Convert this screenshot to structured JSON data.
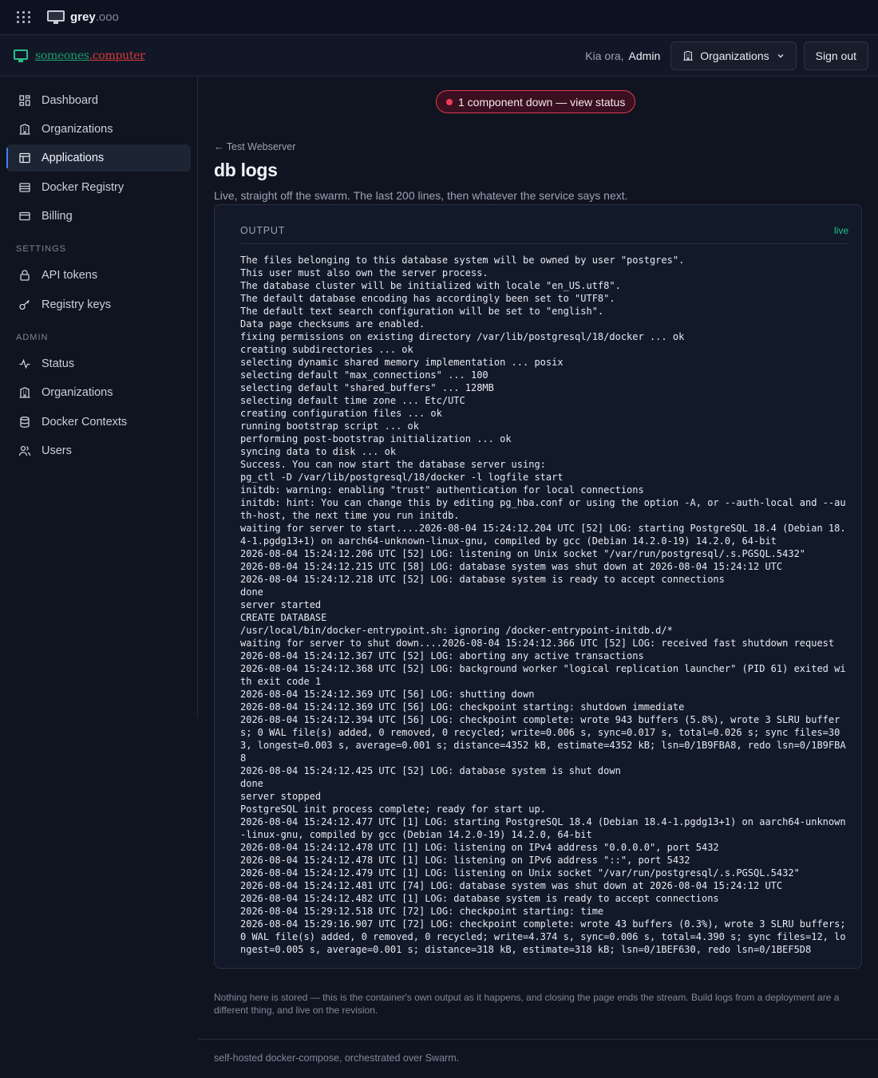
{
  "topbar": {
    "brand_name": "grey",
    "brand_suffix": ".ooo",
    "icons": [
      "grid-menu-icon",
      "monitor-icon"
    ]
  },
  "header": {
    "logo_part1": "someones",
    "logo_part2": ".computer",
    "greeting": "Kia ora,",
    "user_name": "Admin",
    "organizations_label": "Organizations",
    "signout_label": "Sign out"
  },
  "sidebar": {
    "items": [
      {
        "label": "Dashboard",
        "icon": "dashboard-icon"
      },
      {
        "label": "Organizations",
        "icon": "building-icon"
      },
      {
        "label": "Applications",
        "icon": "layout-icon",
        "active": true
      },
      {
        "label": "Docker Registry",
        "icon": "registry-icon"
      }
    ],
    "items2": [
      {
        "label": "Billing",
        "icon": "card-icon"
      }
    ],
    "settings_label": "SETTINGS",
    "settings_items": [
      {
        "label": "API tokens",
        "icon": "lock-icon"
      },
      {
        "label": "Registry keys",
        "icon": "key-icon"
      }
    ],
    "admin_label": "ADMIN",
    "admin_items": [
      {
        "label": "Status",
        "icon": "activity-icon"
      },
      {
        "label": "Organizations",
        "icon": "building-icon"
      },
      {
        "label": "Docker Contexts",
        "icon": "database-icon"
      },
      {
        "label": "Users",
        "icon": "users-icon"
      }
    ]
  },
  "main": {
    "status_banner": "1 component down — view status",
    "back_link": "Test Webserver",
    "title": "db logs",
    "subtitle": "Live, straight off the swarm. The last 200 lines, then whatever the service says next.",
    "output_label": "OUTPUT",
    "live_label": "live",
    "log_lines": [
      "The files belonging to this database system will be owned by user \"postgres\".",
      "This user must also own the server process.",
      "The database cluster will be initialized with locale \"en_US.utf8\".",
      "The default database encoding has accordingly been set to \"UTF8\".",
      "The default text search configuration will be set to \"english\".",
      "Data page checksums are enabled.",
      "fixing permissions on existing directory /var/lib/postgresql/18/docker ... ok",
      "creating subdirectories ... ok",
      "selecting dynamic shared memory implementation ... posix",
      "selecting default \"max_connections\" ... 100",
      "selecting default \"shared_buffers\" ... 128MB",
      "selecting default time zone ... Etc/UTC",
      "creating configuration files ... ok",
      "running bootstrap script ... ok",
      "performing post-bootstrap initialization ... ok",
      "syncing data to disk ... ok",
      "Success. You can now start the database server using:",
      "pg_ctl -D /var/lib/postgresql/18/docker -l logfile start",
      "initdb: warning: enabling \"trust\" authentication for local connections",
      "initdb: hint: You can change this by editing pg_hba.conf or using the option -A, or --auth-local and --auth-host, the next time you run initdb.",
      "waiting for server to start....2026-08-04 15:24:12.204 UTC [52] LOG: starting PostgreSQL 18.4 (Debian 18.4-1.pgdg13+1) on aarch64-unknown-linux-gnu, compiled by gcc (Debian 14.2.0-19) 14.2.0, 64-bit",
      "2026-08-04 15:24:12.206 UTC [52] LOG: listening on Unix socket \"/var/run/postgresql/.s.PGSQL.5432\"",
      "2026-08-04 15:24:12.215 UTC [58] LOG: database system was shut down at 2026-08-04 15:24:12 UTC",
      "2026-08-04 15:24:12.218 UTC [52] LOG: database system is ready to accept connections",
      "done",
      "server started",
      "CREATE DATABASE",
      "/usr/local/bin/docker-entrypoint.sh: ignoring /docker-entrypoint-initdb.d/*",
      "waiting for server to shut down....2026-08-04 15:24:12.366 UTC [52] LOG: received fast shutdown request",
      "2026-08-04 15:24:12.367 UTC [52] LOG: aborting any active transactions",
      "2026-08-04 15:24:12.368 UTC [52] LOG: background worker \"logical replication launcher\" (PID 61) exited with exit code 1",
      "2026-08-04 15:24:12.369 UTC [56] LOG: shutting down",
      "2026-08-04 15:24:12.369 UTC [56] LOG: checkpoint starting: shutdown immediate",
      "2026-08-04 15:24:12.394 UTC [56] LOG: checkpoint complete: wrote 943 buffers (5.8%), wrote 3 SLRU buffers; 0 WAL file(s) added, 0 removed, 0 recycled; write=0.006 s, sync=0.017 s, total=0.026 s; sync files=303, longest=0.003 s, average=0.001 s; distance=4352 kB, estimate=4352 kB; lsn=0/1B9FBA8, redo lsn=0/1B9FBA8",
      "2026-08-04 15:24:12.425 UTC [52] LOG: database system is shut down",
      "done",
      "server stopped",
      "PostgreSQL init process complete; ready for start up.",
      "2026-08-04 15:24:12.477 UTC [1] LOG: starting PostgreSQL 18.4 (Debian 18.4-1.pgdg13+1) on aarch64-unknown-linux-gnu, compiled by gcc (Debian 14.2.0-19) 14.2.0, 64-bit",
      "2026-08-04 15:24:12.478 UTC [1] LOG: listening on IPv4 address \"0.0.0.0\", port 5432",
      "2026-08-04 15:24:12.478 UTC [1] LOG: listening on IPv6 address \"::\", port 5432",
      "2026-08-04 15:24:12.479 UTC [1] LOG: listening on Unix socket \"/var/run/postgresql/.s.PGSQL.5432\"",
      "2026-08-04 15:24:12.481 UTC [74] LOG: database system was shut down at 2026-08-04 15:24:12 UTC",
      "2026-08-04 15:24:12.482 UTC [1] LOG: database system is ready to accept connections",
      "2026-08-04 15:29:12.518 UTC [72] LOG: checkpoint starting: time",
      "2026-08-04 15:29:16.907 UTC [72] LOG: checkpoint complete: wrote 43 buffers (0.3%), wrote 3 SLRU buffers; 0 WAL file(s) added, 0 removed, 0 recycled; write=4.374 s, sync=0.006 s, total=4.390 s; sync files=12, longest=0.005 s, average=0.001 s; distance=318 kB, estimate=318 kB; lsn=0/1BEF630, redo lsn=0/1BEF5D8"
    ],
    "note": "Nothing here is stored — this is the container's own output as it happens, and closing the page ends the stream. Build logs from a deployment are a different thing, and live on the revision."
  },
  "footer": {
    "text": "self-hosted docker-compose, orchestrated over Swarm."
  },
  "colors": {
    "background": "#0f1420",
    "accent": "#3b82f6",
    "live": "#22c08a",
    "alert": "#e0364e",
    "logo_green": "#1f9e6e",
    "logo_red": "#d93a3a"
  }
}
